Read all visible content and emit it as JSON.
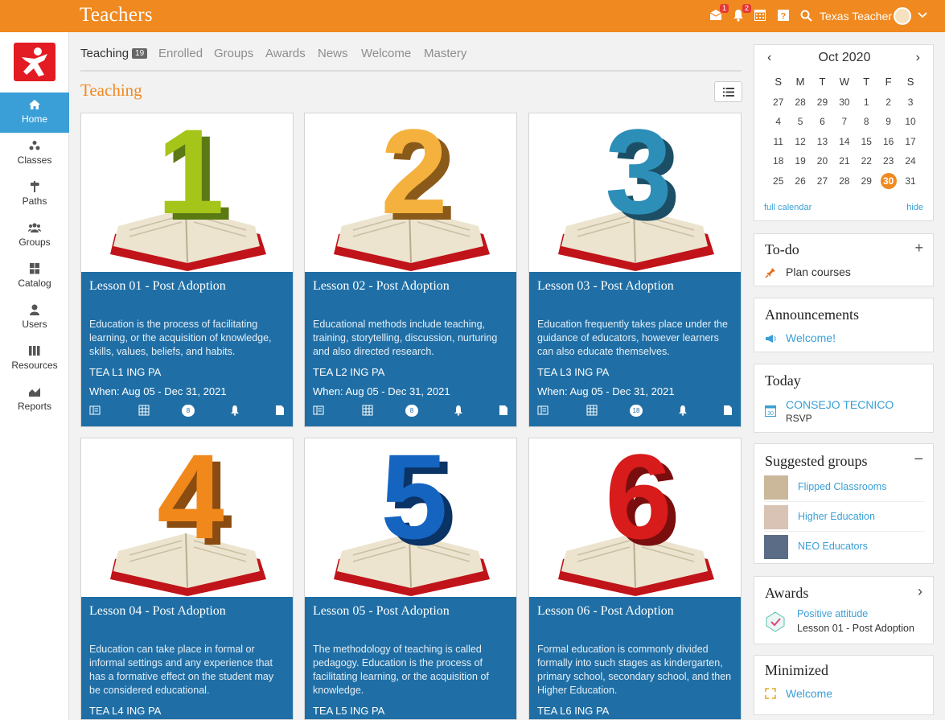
{
  "header": {
    "title": "Teachers",
    "notifications_count_1": "1",
    "notifications_count_2": "2",
    "user_name": "Texas Teacher"
  },
  "sidebar": {
    "items": [
      {
        "label": "Home",
        "icon": "home-icon"
      },
      {
        "label": "Classes",
        "icon": "classes-icon"
      },
      {
        "label": "Paths",
        "icon": "paths-icon"
      },
      {
        "label": "Groups",
        "icon": "groups-icon"
      },
      {
        "label": "Catalog",
        "icon": "catalog-icon"
      },
      {
        "label": "Users",
        "icon": "users-icon"
      },
      {
        "label": "Resources",
        "icon": "resources-icon"
      },
      {
        "label": "Reports",
        "icon": "reports-icon"
      }
    ]
  },
  "tabs": [
    {
      "label": "Teaching",
      "count": "19"
    },
    {
      "label": "Enrolled"
    },
    {
      "label": "Groups"
    },
    {
      "label": "Awards"
    },
    {
      "label": "News"
    },
    {
      "label": "Welcome"
    },
    {
      "label": "Mastery"
    }
  ],
  "main": {
    "section_title": "Teaching"
  },
  "cards": [
    {
      "numeral": "1",
      "title": "Lesson 01 - Post Adoption",
      "desc": "Education is the process of facilitating learning, or the acquisition of knowledge, skills, values, beliefs, and habits.",
      "code": "TEA L1 ING PA",
      "when": "When: Aug 05 - Dec 31, 2021",
      "badge": "8",
      "color": "#a6c51a",
      "shade": "#5c7a14"
    },
    {
      "numeral": "2",
      "title": "Lesson 02 - Post Adoption",
      "desc": "Educational methods include teaching, training, storytelling, discussion, nurturing and also directed research.",
      "code": "TEA L2 ING PA",
      "when": "When: Aug 05 - Dec 31, 2021",
      "badge": "8",
      "color": "#f4b13e",
      "shade": "#8a5a1a"
    },
    {
      "numeral": "3",
      "title": "Lesson 03 - Post Adoption",
      "desc": "Education frequently takes place under the guidance of educators, however learners can also educate themselves.",
      "code": "TEA L3 ING PA",
      "when": "When: Aug 05 - Dec 31, 2021",
      "badge": "18",
      "color": "#2d8fb8",
      "shade": "#1c4f66"
    },
    {
      "numeral": "4",
      "title": "Lesson 04 - Post Adoption",
      "desc": "Education can take place in formal or informal settings and any experience that has a formative effect on the student may be considered educational.",
      "code": "TEA L4 ING PA",
      "color": "#f0881c",
      "shade": "#8a4c10"
    },
    {
      "numeral": "5",
      "title": "Lesson 05 - Post Adoption",
      "desc": "The methodology of teaching is called pedagogy. Education is the process of facilitating learning, or the acquisition of knowledge.",
      "code": "TEA L5 ING PA",
      "color": "#1565c0",
      "shade": "#0a3366"
    },
    {
      "numeral": "6",
      "title": "Lesson 06 - Post Adoption",
      "desc": "Formal education is commonly divided formally into such stages as kindergarten, primary school, secondary school, and then Higher Education.",
      "code": "TEA L6 ING PA",
      "color": "#d81b1b",
      "shade": "#7a0e0e"
    }
  ],
  "calendar": {
    "month": "Oct 2020",
    "weekdays": [
      "S",
      "M",
      "T",
      "W",
      "T",
      "F",
      "S"
    ],
    "weeks": [
      [
        "27",
        "28",
        "29",
        "30",
        "1",
        "2",
        "3"
      ],
      [
        "4",
        "5",
        "6",
        "7",
        "8",
        "9",
        "10"
      ],
      [
        "11",
        "12",
        "13",
        "14",
        "15",
        "16",
        "17"
      ],
      [
        "18",
        "19",
        "20",
        "21",
        "22",
        "23",
        "24"
      ],
      [
        "25",
        "26",
        "27",
        "28",
        "29",
        "30",
        "31"
      ]
    ],
    "today": "30",
    "full_calendar": "full calendar",
    "hide": "hide"
  },
  "todo": {
    "title": "To-do",
    "item": "Plan courses"
  },
  "announcements": {
    "title": "Announcements",
    "item": "Welcome!"
  },
  "today": {
    "title": "Today",
    "event": "CONSEJO TECNICO",
    "rsvp": "RSVP"
  },
  "suggested_groups": {
    "title": "Suggested groups",
    "items": [
      "Flipped Classrooms",
      "Higher Education",
      "NEO Educators"
    ]
  },
  "awards": {
    "title": "Awards",
    "award": "Positive attitude",
    "lesson": "Lesson 01 - Post Adoption"
  },
  "minimized": {
    "title": "Minimized",
    "item": "Welcome"
  }
}
